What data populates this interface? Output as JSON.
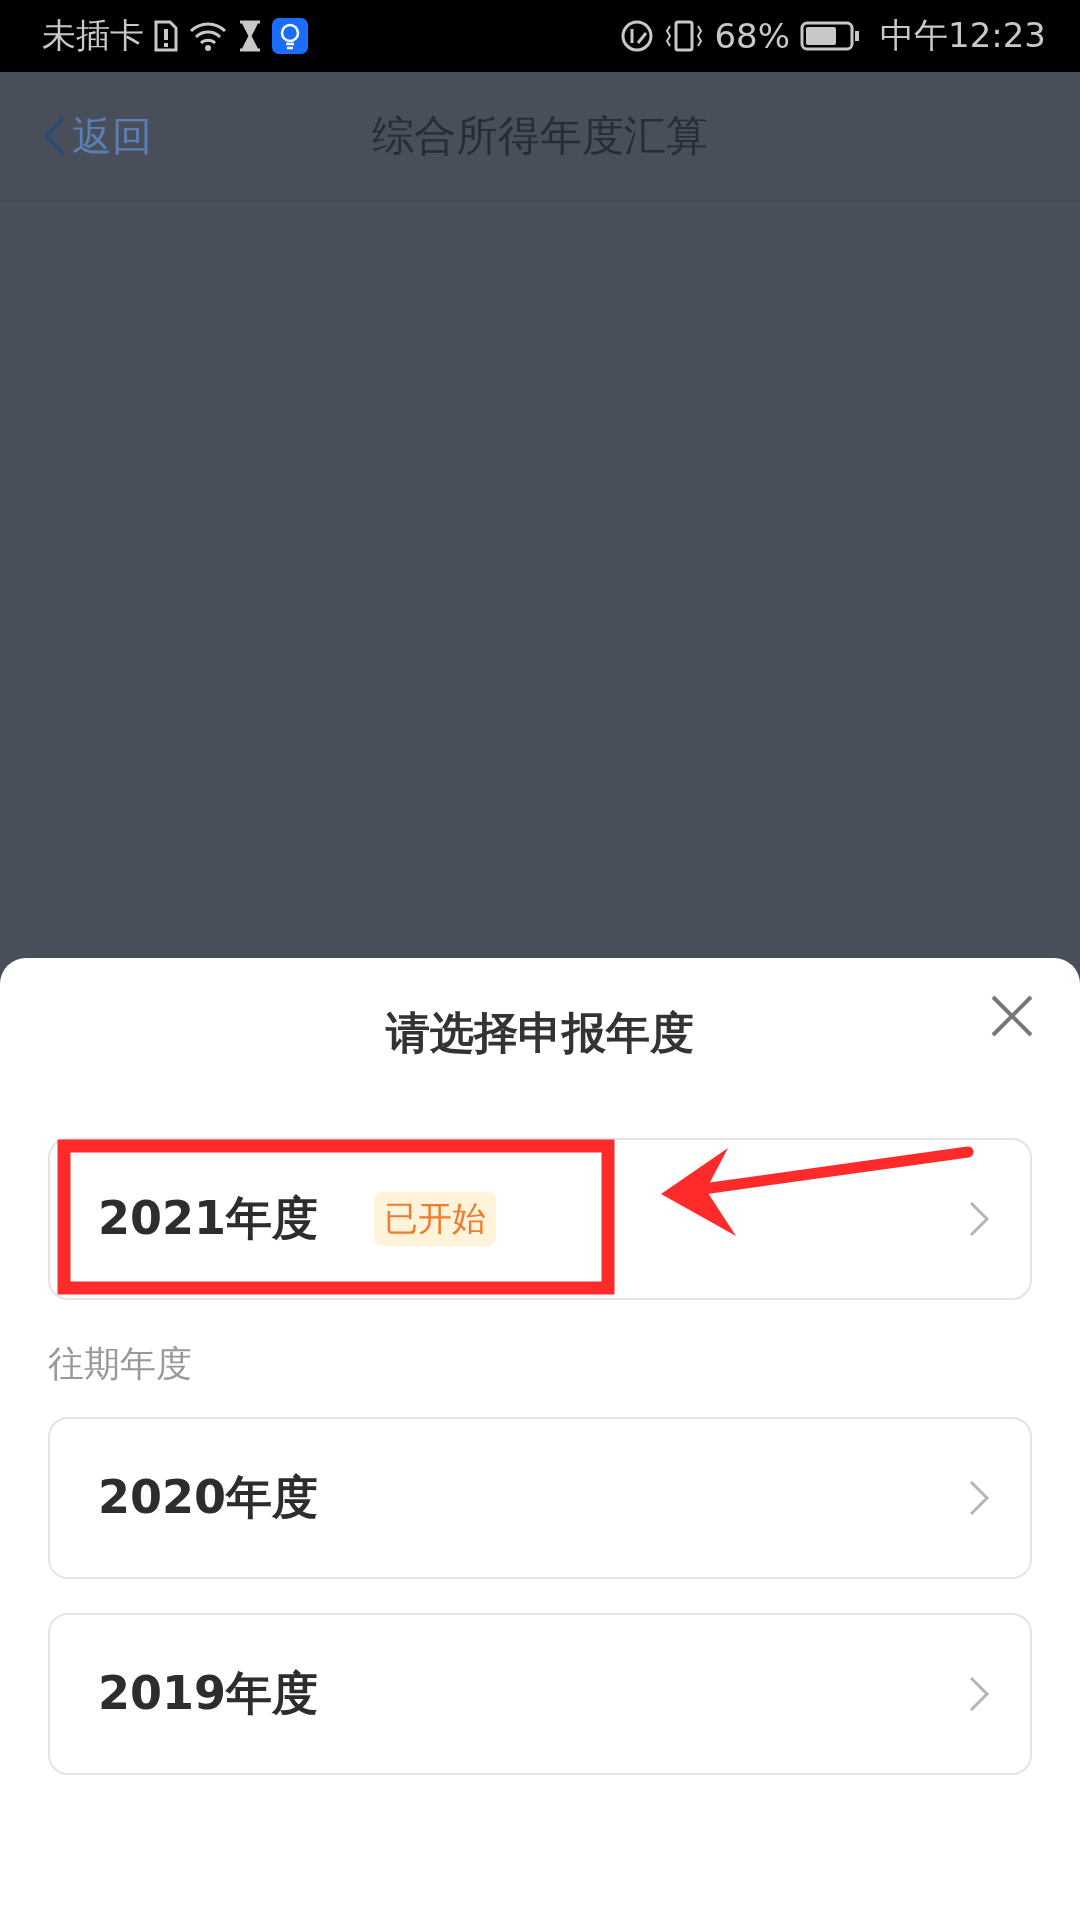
{
  "status_bar": {
    "carrier": "未插卡",
    "battery": "68%",
    "time": "中午12:23"
  },
  "nav_bar": {
    "back": "返回",
    "title": "综合所得年度汇算"
  },
  "sheet": {
    "title": "请选择申报年度",
    "current": [
      {
        "label": "2021年度",
        "tag": "已开始"
      }
    ],
    "past_label": "往期年度",
    "past": [
      {
        "label": "2020年度"
      },
      {
        "label": "2019年度"
      }
    ]
  }
}
